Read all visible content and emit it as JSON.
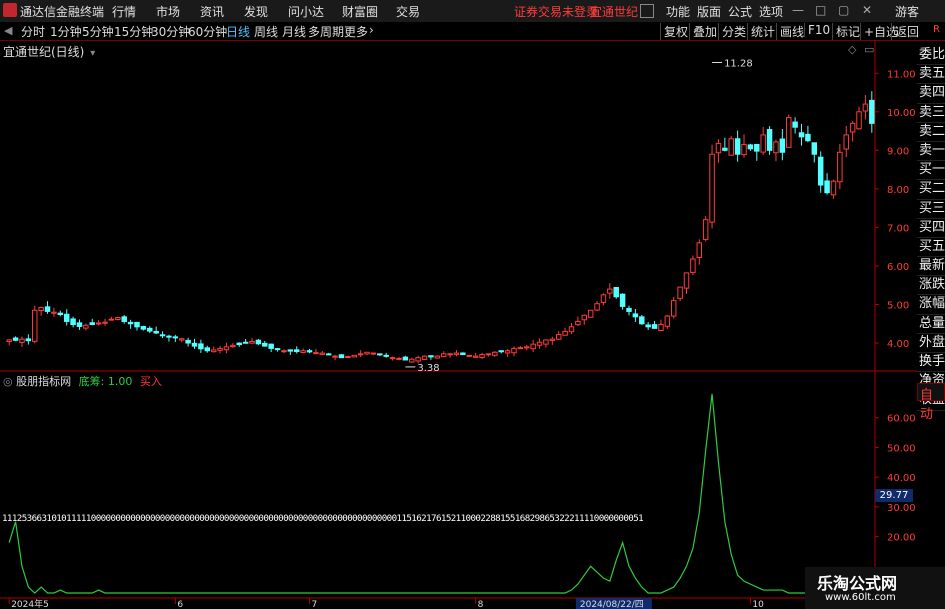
{
  "window": {
    "app_name": "通达信金融终端",
    "menus": [
      "行情",
      "市场",
      "资讯",
      "发现",
      "问小达",
      "财富圈",
      "交易"
    ],
    "warning": "证券交易未登录",
    "stock": "宜通世纪",
    "right_menus": [
      "功能",
      "版面",
      "公式",
      "选项"
    ],
    "guest": "游客"
  },
  "period_bar": {
    "periods": [
      "分时",
      "1分钟",
      "5分钟",
      "15分钟",
      "30分钟",
      "60分钟",
      "日线",
      "周线",
      "月线",
      "多周期",
      "更多"
    ],
    "selected": "日线",
    "tools": [
      "复权",
      "叠加",
      "分类",
      "统计",
      "画线",
      "F10",
      "标记",
      "+自选",
      "返回"
    ]
  },
  "chart_header": {
    "name": "宜通世纪(日线)"
  },
  "sidebar_items": [
    "委比",
    "卖五",
    "卖四",
    "卖三",
    "卖二",
    "卖一",
    "买一",
    "买二",
    "买三",
    "买四",
    "买五",
    "最新",
    "涨跌",
    "涨幅",
    "总量",
    "外盘",
    "换手",
    "净资",
    "收益"
  ],
  "sidebar_auto": "自动",
  "indicator": {
    "name": "股朋指标网",
    "field": "底筹:",
    "value": "1.00",
    "signal": "买入",
    "current_label": "29.77",
    "digits_row": "1112536631010111110000000000000000000000000000000000000000000000000000000000000011516217615211000228815516829865322211110000000051"
  },
  "watermark": {
    "title": "乐淘公式网",
    "url": "www.60lt.com"
  },
  "colors": {
    "up": "#ff3b3b",
    "down": "#54ffff",
    "axis": "#b00000",
    "indicator_line": "#2ecc40"
  },
  "chart_data": [
    {
      "type": "candlestick",
      "title": "宜通世纪(日线)",
      "ylim": [
        3.3,
        11.5
      ],
      "yticks": [
        4.0,
        5.0,
        6.0,
        7.0,
        8.0,
        9.0,
        10.0,
        11.0
      ],
      "annotations": [
        {
          "label": "11.28",
          "value": 11.28
        },
        {
          "label": "3.38",
          "value": 3.38
        }
      ],
      "closes": [
        4.08,
        4.07,
        4.1,
        4.06,
        4.85,
        4.92,
        4.82,
        4.8,
        4.74,
        4.56,
        4.48,
        4.43,
        4.46,
        4.48,
        4.52,
        4.54,
        4.62,
        4.66,
        4.56,
        4.5,
        4.42,
        4.36,
        4.31,
        4.26,
        4.2,
        4.16,
        4.14,
        4.11,
        4.0,
        3.92,
        3.85,
        3.8,
        3.82,
        3.86,
        3.9,
        3.94,
        3.96,
        4.0,
        4.04,
        3.98,
        3.92,
        3.86,
        3.84,
        3.8,
        3.79,
        3.78,
        3.8,
        3.77,
        3.75,
        3.74,
        3.7,
        3.66,
        3.62,
        3.65,
        3.68,
        3.72,
        3.76,
        3.74,
        3.7,
        3.66,
        3.62,
        3.6,
        3.56,
        3.58,
        3.62,
        3.66,
        3.64,
        3.66,
        3.72,
        3.72,
        3.74,
        3.7,
        3.68,
        3.66,
        3.7,
        3.72,
        3.76,
        3.78,
        3.8,
        3.86,
        3.88,
        3.9,
        3.97,
        4.02,
        4.08,
        4.1,
        4.22,
        4.3,
        4.42,
        4.56,
        4.72,
        4.85,
        5.02,
        5.25,
        5.4,
        5.2,
        4.95,
        4.82,
        4.68,
        4.5,
        4.42,
        4.38,
        4.48,
        4.7,
        5.1,
        5.45,
        5.82,
        6.18,
        6.6,
        7.2,
        8.9,
        9.18,
        9.0,
        9.3,
        8.9,
        9.15,
        9.04,
        8.98,
        9.4,
        9.0,
        9.22,
        8.95,
        9.85,
        9.6,
        9.35,
        9.25,
        8.9,
        8.1,
        7.9,
        8.2,
        8.95,
        9.4,
        9.7,
        10.0,
        10.2,
        9.7
      ],
      "indicator": {
        "name": "股朋指标网",
        "ylim": [
          0,
          70
        ],
        "yticks": [
          20.0,
          30.0,
          40.0,
          50.0,
          60.0
        ],
        "values": [
          18,
          25,
          10,
          3,
          1,
          3,
          1,
          1,
          2,
          1,
          1,
          1,
          1,
          1,
          2,
          1,
          1,
          1,
          1,
          1,
          1,
          1,
          1,
          1,
          1,
          1,
          1,
          1,
          1,
          1,
          1,
          1,
          1,
          1,
          1,
          1,
          1,
          1,
          1,
          1,
          1,
          1,
          1,
          1,
          1,
          1,
          1,
          1,
          1,
          1,
          1,
          1,
          1,
          1,
          1,
          1,
          1,
          1,
          1,
          1,
          1,
          1,
          1,
          1,
          1,
          1,
          1,
          1,
          1,
          1,
          1,
          1,
          1,
          1,
          1,
          1,
          1,
          1,
          1,
          1,
          1,
          1,
          1,
          1,
          1,
          1,
          1,
          1,
          2,
          4,
          7,
          10,
          8,
          6,
          5,
          12,
          18,
          10,
          6,
          3,
          1,
          1,
          1,
          2,
          3,
          6,
          10,
          16,
          28,
          49,
          68,
          45,
          25,
          14,
          7,
          5,
          4,
          3,
          2,
          2,
          2,
          2,
          1,
          1,
          1,
          1,
          1,
          1,
          1,
          1,
          1,
          1,
          1,
          1,
          1,
          1
        ]
      },
      "x_ticks": [
        {
          "label": "2024年5",
          "idx": 0
        },
        {
          "label": "6",
          "idx": 26
        },
        {
          "label": "7",
          "idx": 47
        },
        {
          "label": "8",
          "idx": 73
        },
        {
          "label": "2024/08/22/四",
          "idx": 89
        },
        {
          "label": "10",
          "idx": 116
        }
      ]
    }
  ]
}
